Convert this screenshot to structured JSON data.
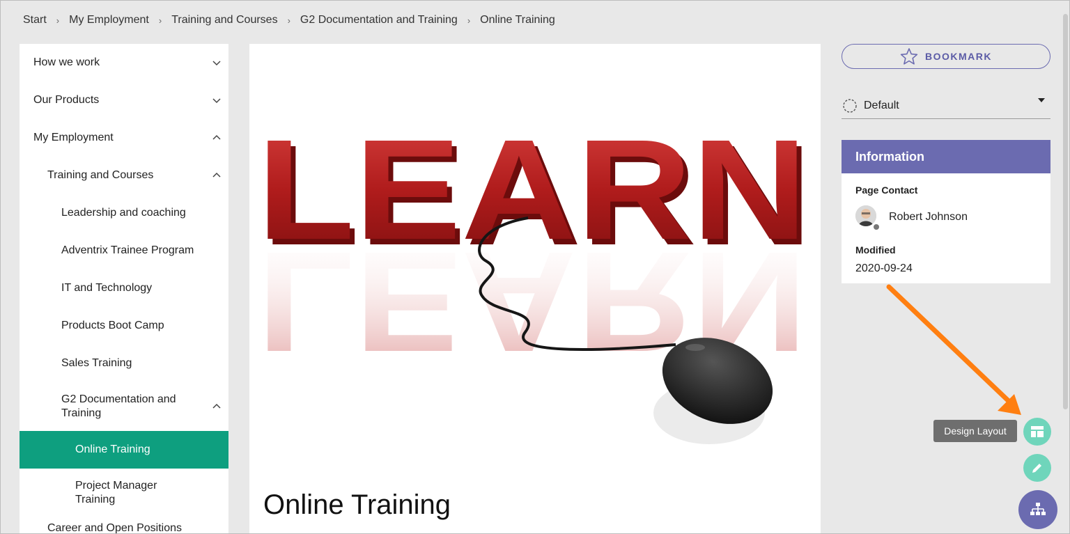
{
  "breadcrumb": [
    "Start",
    "My Employment",
    "Training and Courses",
    "G2 Documentation and Training",
    "Online Training"
  ],
  "sidebar": {
    "items": [
      {
        "label": "How we work",
        "level": 0,
        "state": "collapsed"
      },
      {
        "label": "Our Products",
        "level": 0,
        "state": "collapsed"
      },
      {
        "label": "My Employment",
        "level": 0,
        "state": "expanded"
      },
      {
        "label": "Training and Courses",
        "level": 1,
        "state": "expanded"
      },
      {
        "label": "Leadership and coaching",
        "level": 2,
        "state": "none"
      },
      {
        "label": "Adventrix Trainee Program",
        "level": 2,
        "state": "none"
      },
      {
        "label": "IT and Technology",
        "level": 2,
        "state": "none"
      },
      {
        "label": "Products Boot Camp",
        "level": 2,
        "state": "none"
      },
      {
        "label": "Sales Training",
        "level": 2,
        "state": "none"
      },
      {
        "label": "G2 Documentation and Training",
        "level": 2,
        "state": "expanded"
      },
      {
        "label": "Online Training",
        "level": 3,
        "state": "active"
      },
      {
        "label": "Project Manager Training",
        "level": 3,
        "state": "none"
      },
      {
        "label": "Career and Open Positions",
        "level": 1,
        "state": "none"
      }
    ]
  },
  "main": {
    "hero_text": "LEARN",
    "title": "Online Training"
  },
  "right": {
    "bookmark_label": "BOOKMARK",
    "select_value": "Default",
    "info": {
      "header": "Information",
      "page_contact_label": "Page Contact",
      "contact_name": "Robert Johnson",
      "modified_label": "Modified",
      "modified_value": "2020-09-24"
    }
  },
  "fabs": {
    "tooltip": "Design Layout",
    "design_icon": "layout-icon",
    "edit_icon": "pencil-icon",
    "sitemap_icon": "sitemap-icon"
  },
  "colors": {
    "accent": "#0e9f7f",
    "purple": "#6b6bb0",
    "fab_green": "#6fd5bb",
    "arrow": "#ff7f11",
    "hero_red": "#b01c1c"
  }
}
